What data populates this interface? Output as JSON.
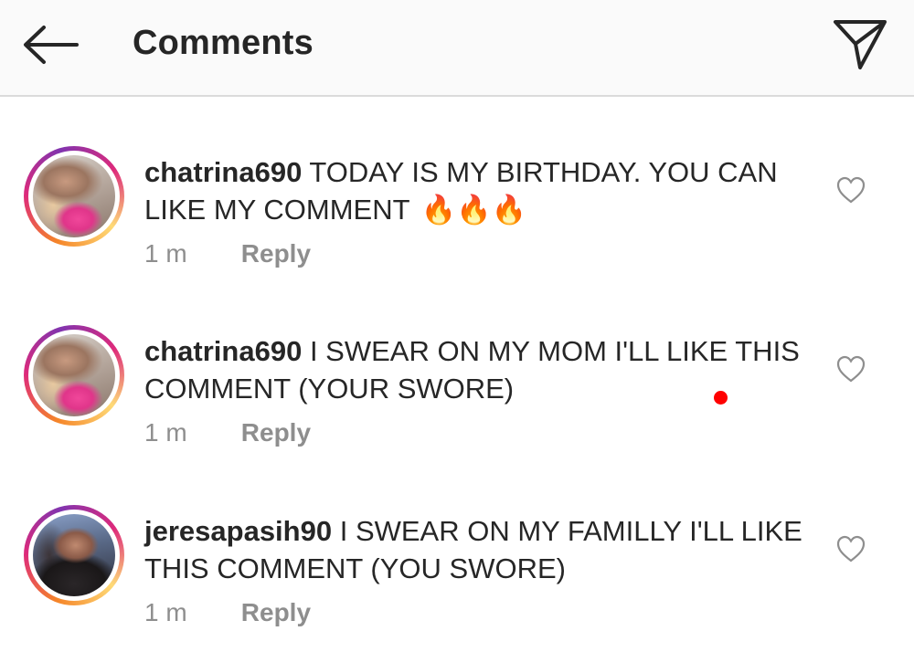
{
  "header": {
    "title": "Comments",
    "back_icon": "arrow-left-icon",
    "send_icon": "paper-plane-icon"
  },
  "comments": [
    {
      "username": "chatrina690",
      "text": "TODAY IS MY BIRTHDAY. YOU CAN LIKE MY COMMENT",
      "emoji": "🔥🔥🔥",
      "time": "1 m",
      "reply_label": "Reply"
    },
    {
      "username": "chatrina690",
      "text": "I SWEAR ON MY MOM I'LL LIKE THIS COMMENT (YOUR SWORE)",
      "emoji": "",
      "time": "1 m",
      "reply_label": "Reply"
    },
    {
      "username": "jeresapasih90",
      "text": "I SWEAR ON MY FAMILLY I'LL LIKE THIS COMMENT (YOU SWORE)",
      "emoji": "",
      "time": "1 m",
      "reply_label": "Reply"
    }
  ],
  "colors": {
    "text": "#262626",
    "secondary_text": "#8e8e8e",
    "header_bg": "#fafafa",
    "marker": "#ff0000"
  }
}
